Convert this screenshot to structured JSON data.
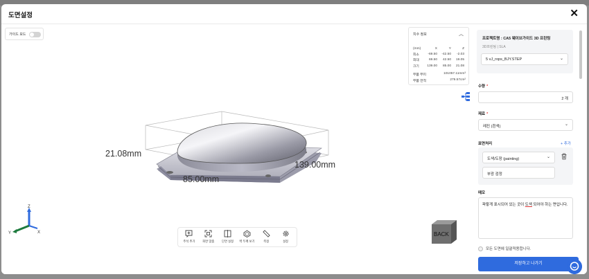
{
  "modal": {
    "title": "도면설정"
  },
  "viewer": {
    "toggle_label": "가이드 모드",
    "dims_panel": {
      "title": "치수 정보",
      "headers": [
        "(mm)",
        "X",
        "Y",
        "Z"
      ],
      "rows": [
        [
          "최소",
          "-69.50",
          "-42.50",
          "-2.03"
        ],
        [
          "최대",
          "69.50",
          "42.50",
          "19.05"
        ],
        [
          "크기",
          "139.00",
          "85.00",
          "21.08"
        ]
      ],
      "volume_label": "부품 부피",
      "volume_value": "101057.11mm³",
      "area_label": "부품 면적",
      "area_value": "279.57cm²"
    },
    "model_dims": {
      "height": "21.08mm",
      "width": "85.00mm",
      "length": "139.00mm"
    },
    "axis": {
      "z": "Z",
      "y": "Y",
      "x": "X"
    },
    "view_cube": {
      "face": "BACK"
    },
    "toolbar": [
      {
        "label": "주석 추가",
        "icon": "comment-add-icon"
      },
      {
        "label": "화면 맞춤",
        "icon": "fit-screen-icon"
      },
      {
        "label": "단면 설정",
        "icon": "section-icon"
      },
      {
        "label": "벽 두께 보기",
        "icon": "wall-thickness-icon"
      },
      {
        "label": "측정",
        "icon": "ruler-icon"
      },
      {
        "label": "설정",
        "icon": "gear-icon"
      }
    ]
  },
  "side": {
    "project_title": "프로젝트명 : CA5 웨이브가이드 3D 프린팅",
    "project_sub": "3D프린팅 | SLA",
    "file": "5 vJ_rops_BJY.STEP",
    "quantity_label": "수량",
    "quantity_value": "2 개",
    "material_label": "재료",
    "material_value": "레진 (흰색)",
    "finish_label": "표면처리",
    "finish_add": "+ 추가",
    "finish_value": "도색/도장 (painting)",
    "finish_detail": "부광 검정",
    "memo_label": "메모",
    "memo_prefix": "파랗게 표시되어 있는 곳이 ",
    "memo_highlight": "도색",
    "memo_suffix": " 되어야 하는 면입니다.",
    "apply_all": "모든 도면에 일괄적용합니다.",
    "save_button": "저장하고 나가기"
  },
  "colors": {
    "accent": "#2f6bde",
    "required": "#e03535"
  }
}
